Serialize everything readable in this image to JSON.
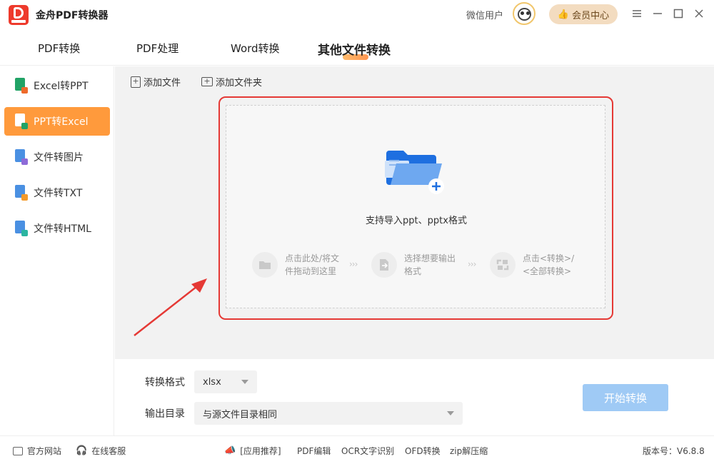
{
  "app": {
    "title": "金舟PDF转换器"
  },
  "titlebar": {
    "user": "微信用户",
    "vip": "会员中心"
  },
  "tabs": [
    "PDF转换",
    "PDF处理",
    "Word转换",
    "其他文件转换"
  ],
  "sidebar": {
    "items": [
      {
        "label": "Excel转PPT",
        "icon": "excel-to-ppt-icon"
      },
      {
        "label": "PPT转Excel",
        "icon": "ppt-to-excel-icon",
        "active": true
      },
      {
        "label": "文件转图片",
        "icon": "file-to-image-icon"
      },
      {
        "label": "文件转TXT",
        "icon": "file-to-txt-icon"
      },
      {
        "label": "文件转HTML",
        "icon": "file-to-html-icon"
      }
    ]
  },
  "toolbar": {
    "add_file": "添加文件",
    "add_folder": "添加文件夹"
  },
  "drop": {
    "support": "支持导入ppt、pptx格式",
    "step1": [
      "点击此处/将文",
      "件拖动到这里"
    ],
    "step2": [
      "选择想要输出",
      "格式"
    ],
    "step3": [
      "点击<转换>/",
      "<全部转换>"
    ]
  },
  "bottom": {
    "format_label": "转换格式",
    "format_value": "xlsx",
    "output_label": "输出目录",
    "output_value": "与源文件目录相同",
    "start": "开始转换"
  },
  "status": {
    "website": "官方网站",
    "service": "在线客服",
    "rec": "[应用推荐]",
    "links": [
      "PDF编辑",
      "OCR文字识别",
      "OFD转换",
      "zip解压缩"
    ],
    "version": "版本号：V6.8.8"
  },
  "colors": {
    "accent": "#ff9a3c",
    "danger": "#e53935",
    "primary_disabled": "#9fcaf5"
  }
}
